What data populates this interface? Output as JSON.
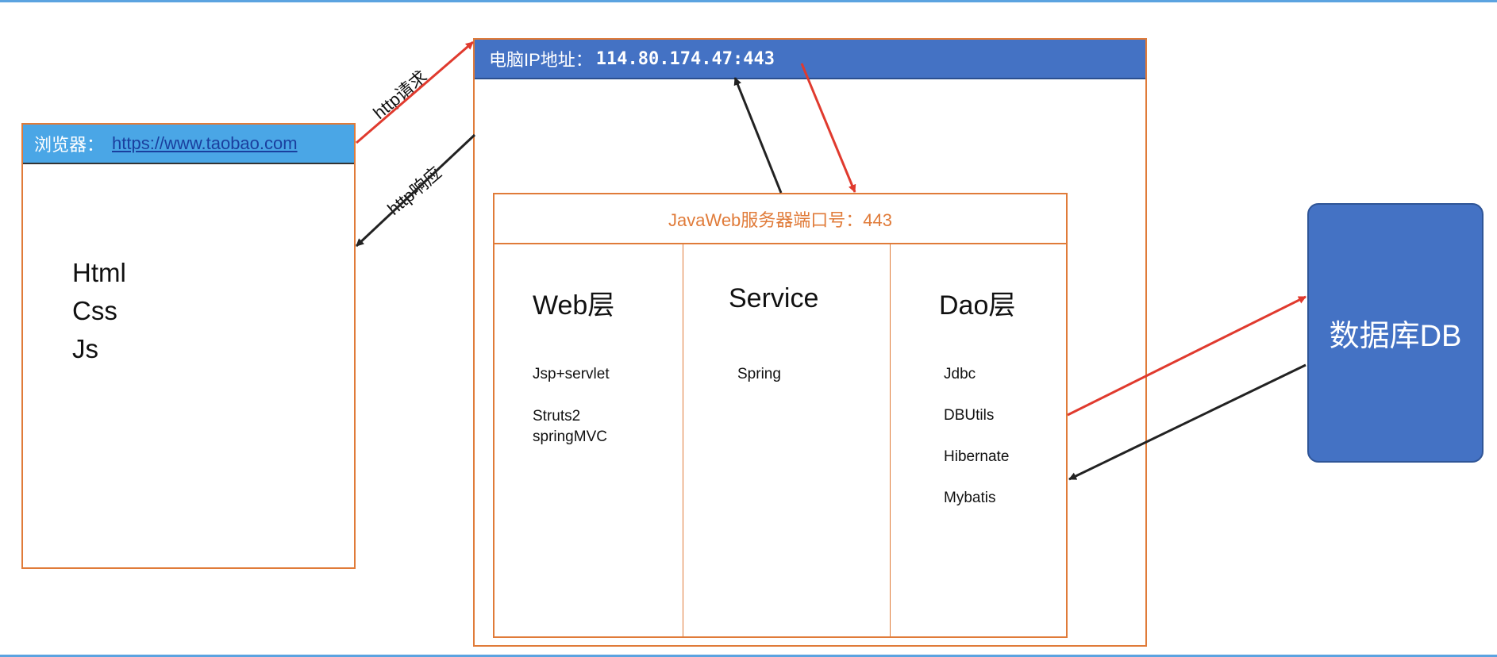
{
  "browser": {
    "label": "浏览器：",
    "url": "https://www.taobao.com",
    "techs": [
      "Html",
      "Css",
      "Js"
    ]
  },
  "server": {
    "ip_label": "电脑IP地址：",
    "ip": "114.80.174.47:443"
  },
  "javaweb": {
    "title": "JavaWeb服务器端口号：443",
    "layers": [
      {
        "title": "Web层",
        "items": [
          "Jsp+servlet",
          "Struts2",
          "springMVC"
        ]
      },
      {
        "title": "Service",
        "items": [
          "Spring"
        ]
      },
      {
        "title": "Dao层",
        "items": [
          "Jdbc",
          "DBUtils",
          "Hibernate",
          "Mybatis"
        ]
      }
    ]
  },
  "database": {
    "label": "数据库DB"
  },
  "arrows": {
    "request_label": "http请求",
    "response_label": "http响应"
  },
  "colors": {
    "request_arrow": "#e03a2e",
    "response_arrow": "#222222",
    "browser_bar": "#4aa6e6",
    "server_bar": "#4472c4",
    "box_border": "#e07b39",
    "database": "#4472c4"
  }
}
